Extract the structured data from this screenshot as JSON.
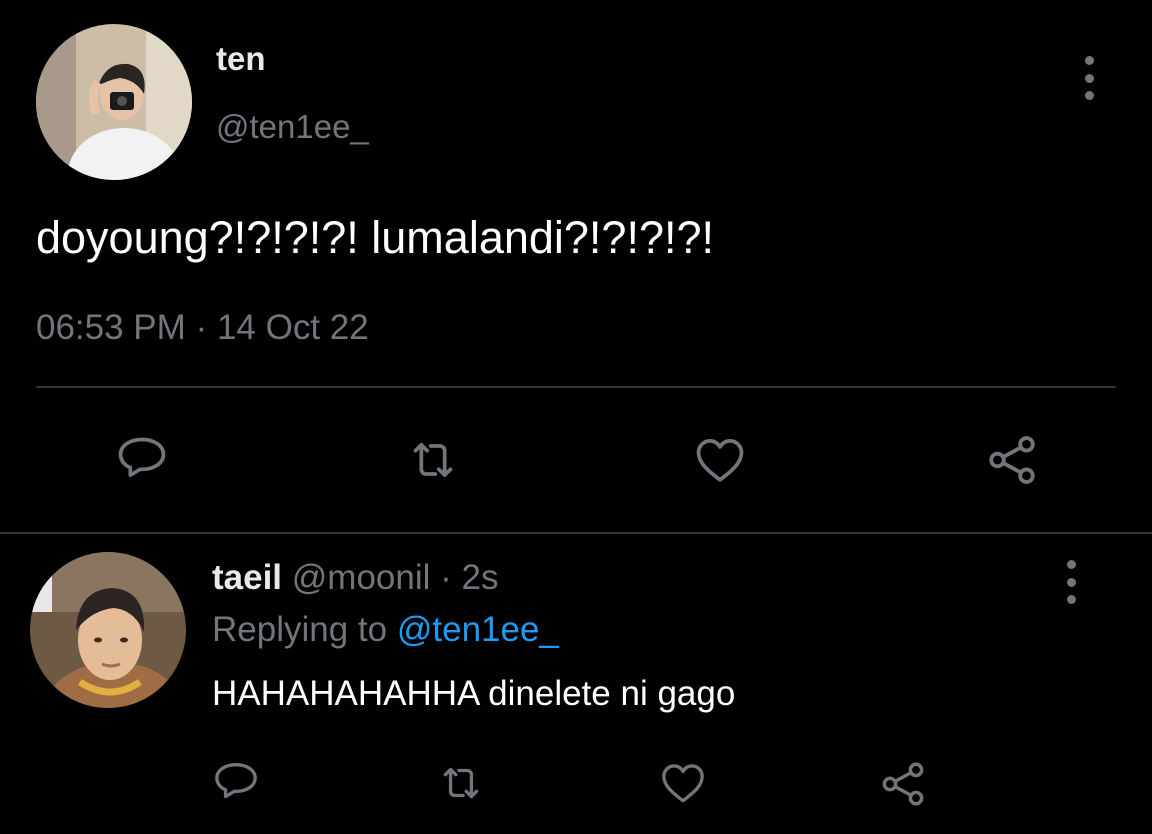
{
  "main_tweet": {
    "display_name": "ten",
    "handle": "@ten1ee_",
    "text": "doyoung?!?!?!?! lumalandi?!?!?!?!",
    "time": "06:53 PM",
    "separator": "·",
    "date": "14 Oct 22",
    "avatar_icon": "profile-photo",
    "actions": [
      "reply-icon",
      "retweet-icon",
      "like-icon",
      "share-icon"
    ]
  },
  "reply_tweet": {
    "display_name": "taeil",
    "handle": "@moonil",
    "separator": "·",
    "age": "2s",
    "replying_prefix": "Replying to",
    "replying_handle": "@ten1ee_",
    "text": "HAHAHAHAHHA dinelete ni gago",
    "avatar_icon": "profile-photo",
    "actions": [
      "reply-icon",
      "retweet-icon",
      "like-icon",
      "share-icon"
    ]
  },
  "colors": {
    "background": "#000000",
    "text": "#e7e9ea",
    "muted": "#71767b",
    "link": "#1d9bf0",
    "divider": "#2f3336"
  }
}
